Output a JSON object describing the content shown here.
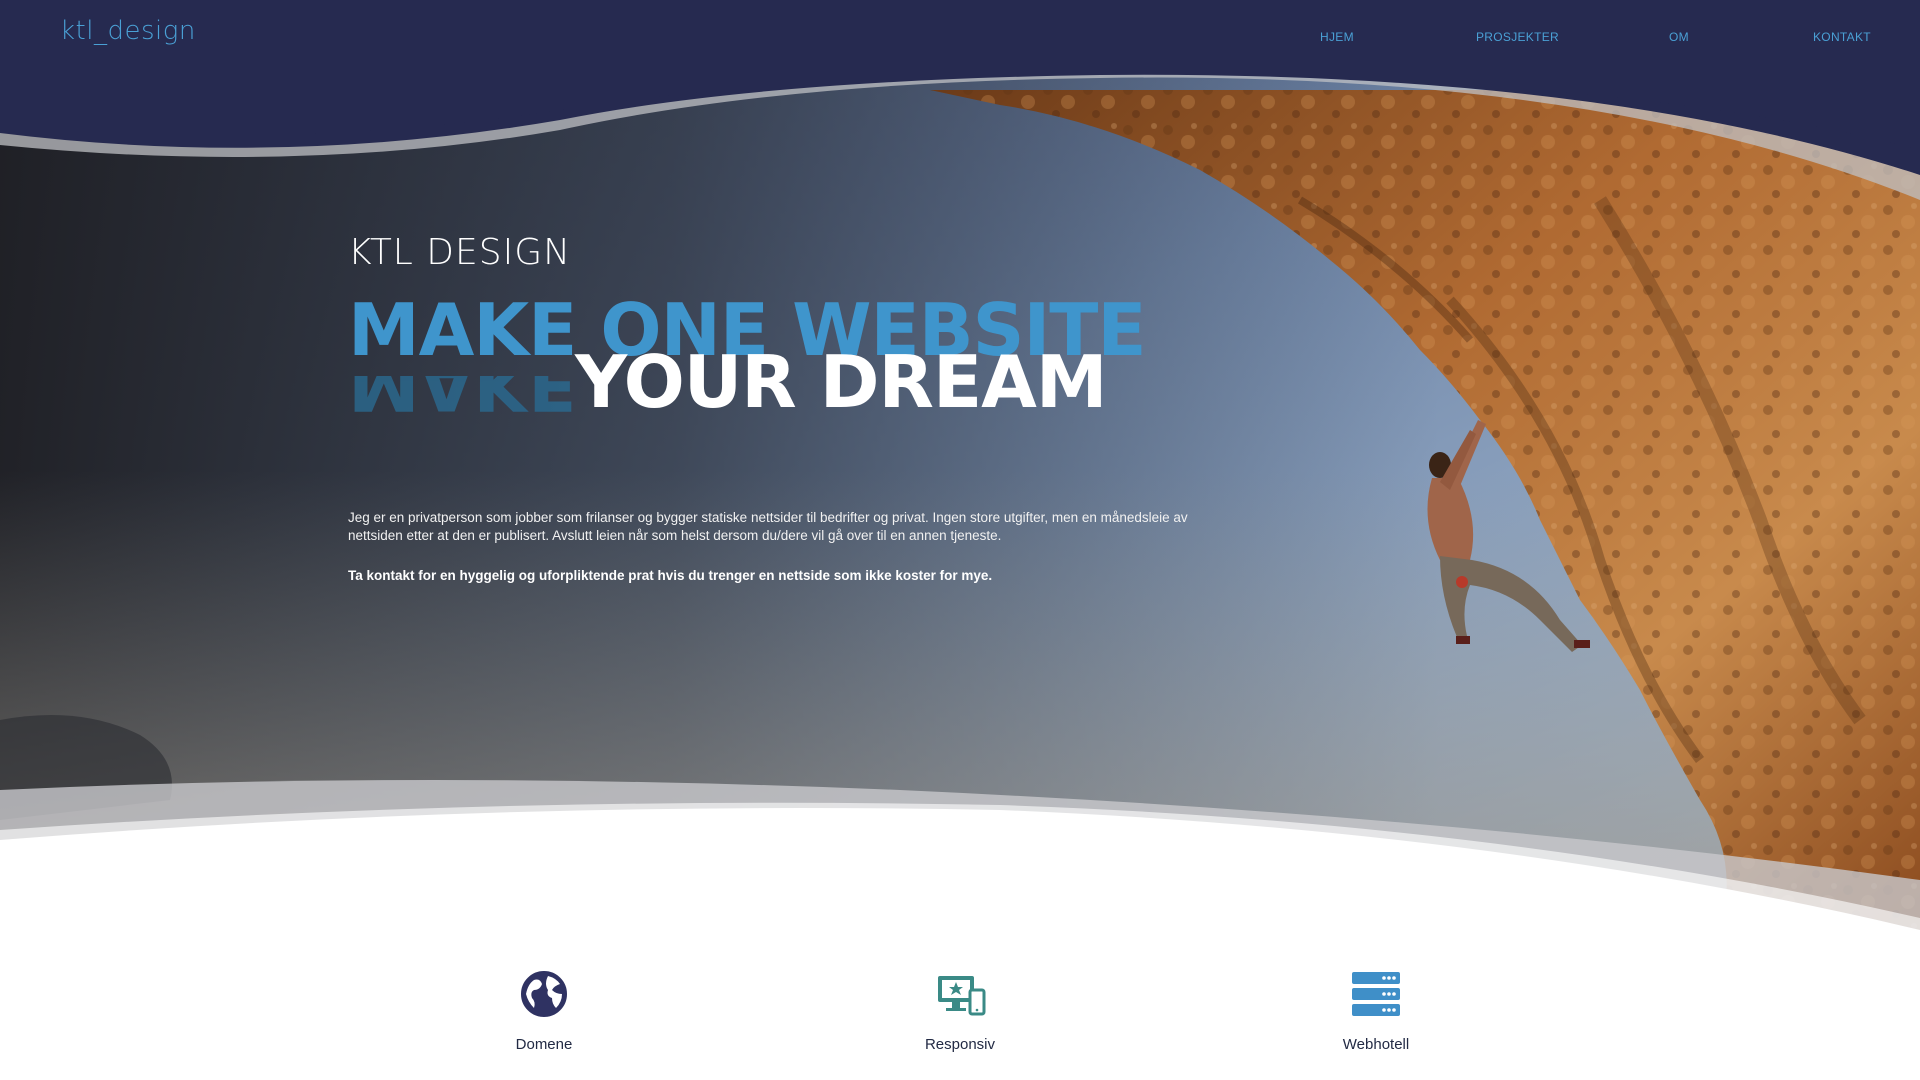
{
  "header": {
    "logo": "ktl_design",
    "nav": [
      {
        "label": "HJEM"
      },
      {
        "label": "PROSJEKTER"
      },
      {
        "label": "OM"
      },
      {
        "label": "KONTAKT"
      }
    ]
  },
  "hero": {
    "brand": "KTL DESIGN",
    "headline_line1": "MAKE ONE WEBSITE",
    "headline_reflection": "MAKE",
    "headline_line2": "YOUR DREAM",
    "intro": "Jeg er en privatperson som jobber som frilanser og bygger statiske nettsider til bedrifter og privat. Ingen store utgifter, men en månedsleie av nettsiden etter at den er publisert. Avslutt leien når som helst dersom du/dere vil gå over til en annen tjeneste.",
    "cta": "Ta kontakt for en hyggelig og uforpliktende prat hvis du trenger en nettside som ikke koster for mye."
  },
  "features": [
    {
      "label": "Domene",
      "icon": "globe-icon"
    },
    {
      "label": "Responsiv",
      "icon": "responsive-devices-icon"
    },
    {
      "label": "Webhotell",
      "icon": "server-icon"
    }
  ],
  "colors": {
    "navy": "#262a50",
    "accent_blue": "#3f95cc",
    "rock": "#a8642e",
    "sky": "#8fb0d2"
  }
}
